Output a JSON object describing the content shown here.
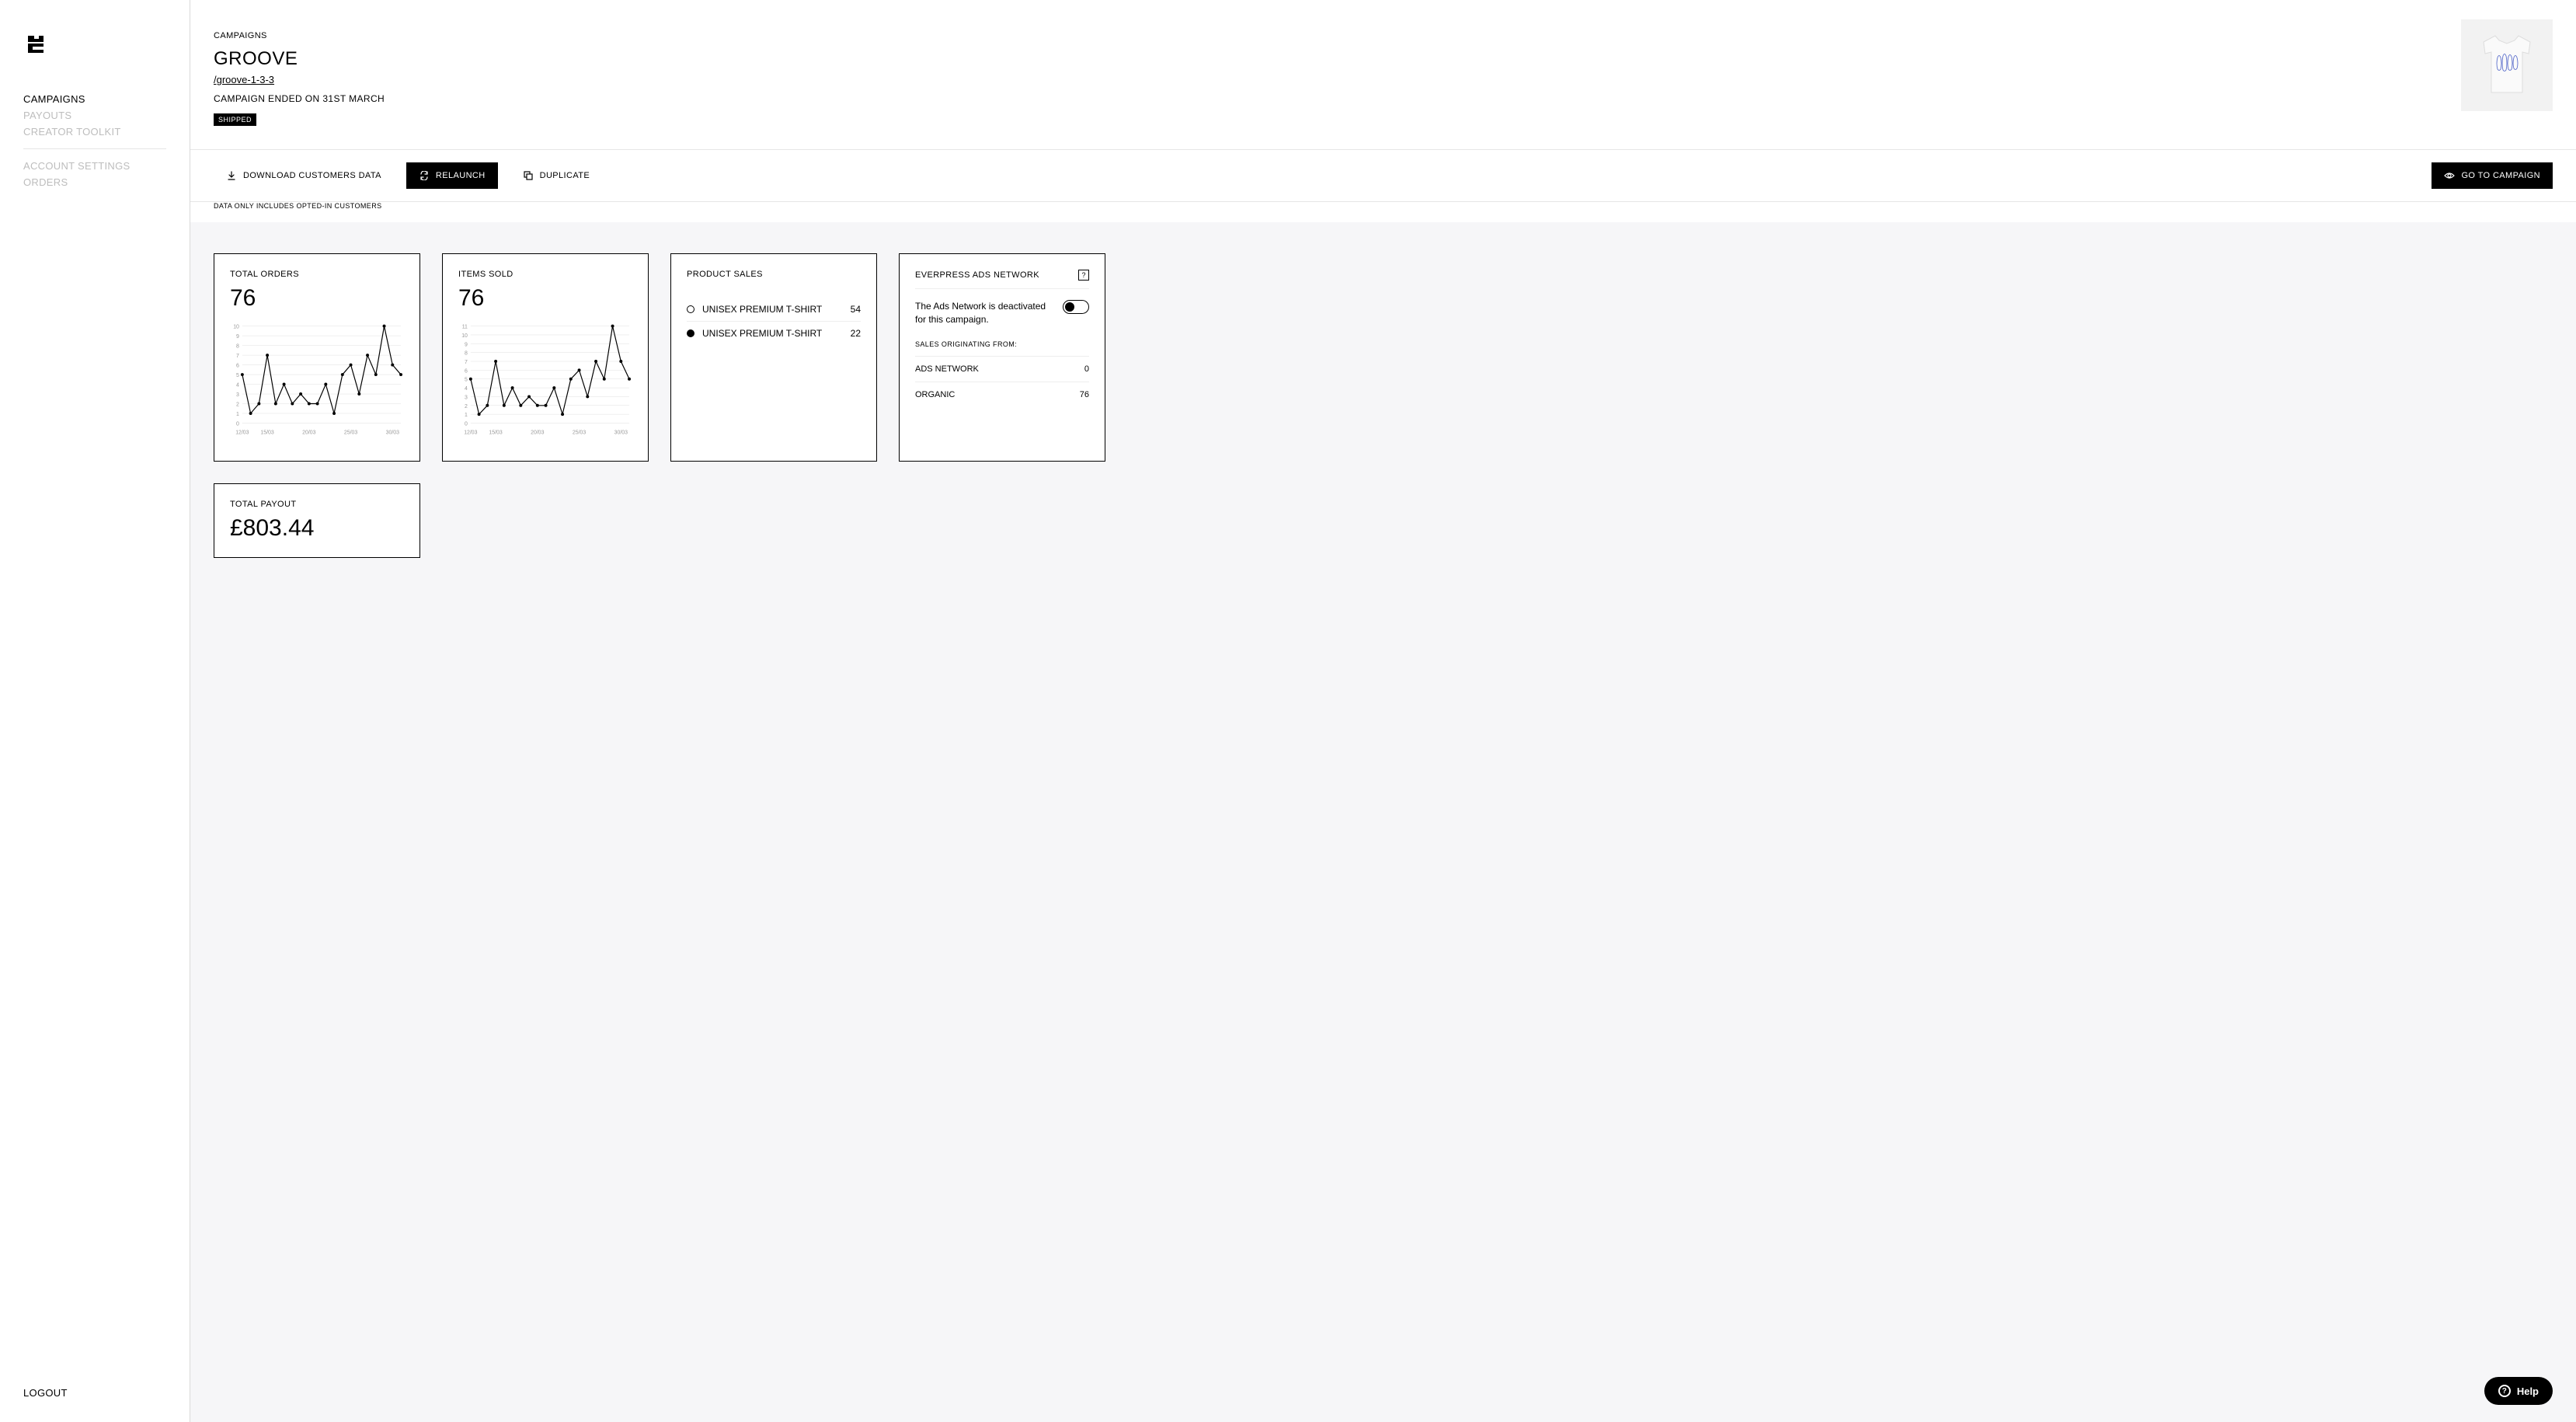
{
  "sidebar": {
    "nav1": [
      {
        "label": "CAMPAIGNS",
        "active": true
      },
      {
        "label": "PAYOUTS",
        "active": false
      },
      {
        "label": "CREATOR TOOLKIT",
        "active": false
      }
    ],
    "nav2": [
      {
        "label": "ACCOUNT SETTINGS"
      },
      {
        "label": "ORDERS"
      }
    ],
    "logout": "LOGOUT"
  },
  "header": {
    "breadcrumb": "CAMPAIGNS",
    "title": "GROOVE",
    "slug": "/groove-1-3-3",
    "ended": "CAMPAIGN ENDED ON 31ST MARCH",
    "badge": "SHIPPED"
  },
  "actions": {
    "download": "DOWNLOAD CUSTOMERS DATA",
    "relaunch": "RELAUNCH",
    "duplicate": "DUPLICATE",
    "goto": "GO TO CAMPAIGN",
    "note": "DATA ONLY INCLUDES OPTED-IN CUSTOMERS"
  },
  "cards": {
    "total_orders": {
      "label": "TOTAL ORDERS",
      "value": "76"
    },
    "items_sold": {
      "label": "ITEMS SOLD",
      "value": "76"
    },
    "product_sales": {
      "label": "PRODUCT SALES",
      "items": [
        {
          "name": "UNISEX PREMIUM T-SHIRT",
          "qty": "54",
          "filled": false
        },
        {
          "name": "UNISEX PREMIUM T-SHIRT",
          "qty": "22",
          "filled": true
        }
      ]
    },
    "ads_network": {
      "label": "EVERPRESS ADS NETWORK",
      "body": "The Ads Network is deactivated for this campaign.",
      "origin_label": "SALES ORIGINATING FROM:",
      "rows": [
        {
          "label": "ADS NETWORK",
          "value": "0"
        },
        {
          "label": "ORGANIC",
          "value": "76"
        }
      ]
    },
    "total_payout": {
      "label": "TOTAL PAYOUT",
      "value": "£803.44"
    }
  },
  "help": {
    "label": "Help"
  },
  "chart_data": [
    {
      "type": "line",
      "title": "TOTAL ORDERS",
      "xlabel": "",
      "ylabel": "",
      "ylim": [
        0,
        10
      ],
      "x_ticks": [
        "12/03",
        "15/03",
        "20/03",
        "25/03",
        "30/03"
      ],
      "categories": [
        "12/03",
        "13/03",
        "14/03",
        "15/03",
        "16/03",
        "17/03",
        "18/03",
        "19/03",
        "20/03",
        "21/03",
        "22/03",
        "23/03",
        "24/03",
        "25/03",
        "26/03",
        "27/03",
        "28/03",
        "29/03",
        "30/03",
        "31/03"
      ],
      "values": [
        5,
        1,
        2,
        7,
        2,
        4,
        2,
        3,
        2,
        2,
        4,
        1,
        5,
        6,
        3,
        7,
        5,
        10,
        6,
        5
      ]
    },
    {
      "type": "line",
      "title": "ITEMS SOLD",
      "xlabel": "",
      "ylabel": "",
      "ylim": [
        0,
        11
      ],
      "x_ticks": [
        "12/03",
        "15/03",
        "20/03",
        "25/03",
        "30/03"
      ],
      "categories": [
        "12/03",
        "13/03",
        "14/03",
        "15/03",
        "16/03",
        "17/03",
        "18/03",
        "19/03",
        "20/03",
        "21/03",
        "22/03",
        "23/03",
        "24/03",
        "25/03",
        "26/03",
        "27/03",
        "28/03",
        "29/03",
        "30/03",
        "31/03"
      ],
      "values": [
        5,
        1,
        2,
        7,
        2,
        4,
        2,
        3,
        2,
        2,
        4,
        1,
        5,
        6,
        3,
        7,
        5,
        11,
        7,
        5
      ]
    }
  ]
}
